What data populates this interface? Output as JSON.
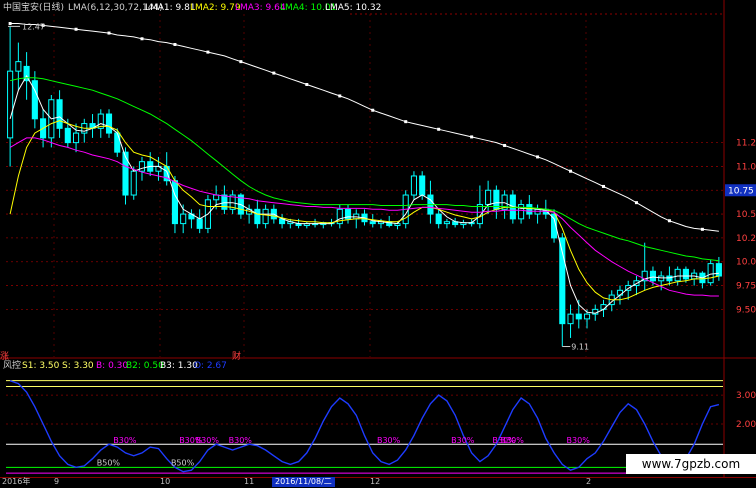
{
  "header": {
    "stock_name": "中国宝安(日线)",
    "indicator": "LMA(6,12,30,72,144)",
    "lma1": "LMA1: 9.81",
    "lma2": "LMA2: 9.79",
    "lma3": "LMA3: 9.64",
    "lma4": "LMA4: 10.01",
    "lma5": "LMA5: 10.32"
  },
  "lower_header": {
    "name": "风控",
    "s1": "S1: 3.50",
    "s": "S: 3.30",
    "b": "B: 0.30",
    "b2": "B2: 0.50",
    "b3": "B3: 1.30",
    "o": "O: 2.67"
  },
  "colors": {
    "up": "#00ffff",
    "down": "#00ffff",
    "lma1": "#ffffff",
    "lma2": "#ffff00",
    "lma3": "#ff00ff",
    "lma4": "#00ff00",
    "lma5": "#ffffff",
    "grid": "#8b0000",
    "axis_text": "#ff4040",
    "osc": "#1e3cff",
    "level_yellow": "#ffff66"
  },
  "price_labels": {
    "high": "12.47",
    "low": "9.11",
    "current": "10.75"
  },
  "tags": {
    "left": "涨",
    "mid": "财"
  },
  "watermark": "www.7gpzb.com",
  "dates": {
    "left_start": "2016年",
    "t1": "9",
    "t2": "10",
    "t3": "11",
    "t4": "12",
    "t5": "2",
    "selected": "2016/11/08/二"
  },
  "chart_data": {
    "type": "candlestick",
    "price_axis": {
      "ticks": [
        "11.25",
        "11.00",
        "10.75",
        "10.50",
        "10.25",
        "10.00",
        "9.75",
        "9.50"
      ],
      "ylim": [
        9.0,
        12.6
      ]
    },
    "candles": [
      {
        "o": 11.3,
        "h": 12.47,
        "l": 11.0,
        "c": 12.0
      },
      {
        "o": 12.0,
        "h": 12.3,
        "l": 11.8,
        "c": 12.1
      },
      {
        "o": 12.05,
        "h": 12.2,
        "l": 11.7,
        "c": 11.9
      },
      {
        "o": 11.9,
        "h": 12.0,
        "l": 11.4,
        "c": 11.5
      },
      {
        "o": 11.5,
        "h": 11.6,
        "l": 11.2,
        "c": 11.3
      },
      {
        "o": 11.3,
        "h": 11.75,
        "l": 11.2,
        "c": 11.7
      },
      {
        "o": 11.7,
        "h": 11.8,
        "l": 11.3,
        "c": 11.4
      },
      {
        "o": 11.4,
        "h": 11.5,
        "l": 11.2,
        "c": 11.25
      },
      {
        "o": 11.25,
        "h": 11.45,
        "l": 11.15,
        "c": 11.35
      },
      {
        "o": 11.35,
        "h": 11.5,
        "l": 11.25,
        "c": 11.45
      },
      {
        "o": 11.45,
        "h": 11.55,
        "l": 11.3,
        "c": 11.4
      },
      {
        "o": 11.4,
        "h": 11.6,
        "l": 11.3,
        "c": 11.55
      },
      {
        "o": 11.55,
        "h": 11.6,
        "l": 11.3,
        "c": 11.35
      },
      {
        "o": 11.35,
        "h": 11.4,
        "l": 11.1,
        "c": 11.15
      },
      {
        "o": 11.15,
        "h": 11.2,
        "l": 10.6,
        "c": 10.7
      },
      {
        "o": 10.7,
        "h": 11.0,
        "l": 10.65,
        "c": 10.95
      },
      {
        "o": 10.95,
        "h": 11.1,
        "l": 10.85,
        "c": 11.05
      },
      {
        "o": 11.05,
        "h": 11.15,
        "l": 10.9,
        "c": 10.95
      },
      {
        "o": 10.95,
        "h": 11.1,
        "l": 10.85,
        "c": 11.0
      },
      {
        "o": 11.0,
        "h": 11.15,
        "l": 10.8,
        "c": 10.85
      },
      {
        "o": 10.85,
        "h": 10.9,
        "l": 10.3,
        "c": 10.4
      },
      {
        "o": 10.4,
        "h": 10.6,
        "l": 10.3,
        "c": 10.5
      },
      {
        "o": 10.5,
        "h": 10.55,
        "l": 10.35,
        "c": 10.45
      },
      {
        "o": 10.45,
        "h": 10.55,
        "l": 10.3,
        "c": 10.35
      },
      {
        "o": 10.35,
        "h": 10.7,
        "l": 10.3,
        "c": 10.65
      },
      {
        "o": 10.65,
        "h": 10.8,
        "l": 10.55,
        "c": 10.7
      },
      {
        "o": 10.7,
        "h": 10.8,
        "l": 10.5,
        "c": 10.55
      },
      {
        "o": 10.55,
        "h": 10.75,
        "l": 10.5,
        "c": 10.7
      },
      {
        "o": 10.7,
        "h": 10.72,
        "l": 10.45,
        "c": 10.5
      },
      {
        "o": 10.5,
        "h": 10.6,
        "l": 10.4,
        "c": 10.55
      },
      {
        "o": 10.55,
        "h": 10.65,
        "l": 10.35,
        "c": 10.4
      },
      {
        "o": 10.4,
        "h": 10.6,
        "l": 10.35,
        "c": 10.55
      },
      {
        "o": 10.55,
        "h": 10.6,
        "l": 10.4,
        "c": 10.45
      },
      {
        "o": 10.45,
        "h": 10.5,
        "l": 10.35,
        "c": 10.4
      },
      {
        "o": 10.4,
        "h": 10.45,
        "l": 10.35,
        "c": 10.42
      },
      {
        "o": 10.4,
        "h": 10.45,
        "l": 10.35,
        "c": 10.38
      },
      {
        "o": 10.38,
        "h": 10.42,
        "l": 10.35,
        "c": 10.4
      },
      {
        "o": 10.4,
        "h": 10.45,
        "l": 10.36,
        "c": 10.39
      },
      {
        "o": 10.39,
        "h": 10.42,
        "l": 10.35,
        "c": 10.41
      },
      {
        "o": 10.41,
        "h": 10.45,
        "l": 10.37,
        "c": 10.4
      },
      {
        "o": 10.4,
        "h": 10.6,
        "l": 10.35,
        "c": 10.55
      },
      {
        "o": 10.55,
        "h": 10.6,
        "l": 10.4,
        "c": 10.45
      },
      {
        "o": 10.45,
        "h": 10.55,
        "l": 10.35,
        "c": 10.5
      },
      {
        "o": 10.5,
        "h": 10.55,
        "l": 10.38,
        "c": 10.42
      },
      {
        "o": 10.42,
        "h": 10.5,
        "l": 10.36,
        "c": 10.4
      },
      {
        "o": 10.4,
        "h": 10.45,
        "l": 10.35,
        "c": 10.42
      },
      {
        "o": 10.42,
        "h": 10.48,
        "l": 10.36,
        "c": 10.38
      },
      {
        "o": 10.38,
        "h": 10.42,
        "l": 10.34,
        "c": 10.4
      },
      {
        "o": 10.4,
        "h": 10.75,
        "l": 10.35,
        "c": 10.7
      },
      {
        "o": 10.7,
        "h": 10.95,
        "l": 10.65,
        "c": 10.9
      },
      {
        "o": 10.9,
        "h": 10.95,
        "l": 10.65,
        "c": 10.7
      },
      {
        "o": 10.7,
        "h": 10.85,
        "l": 10.4,
        "c": 10.5
      },
      {
        "o": 10.5,
        "h": 10.55,
        "l": 10.35,
        "c": 10.4
      },
      {
        "o": 10.4,
        "h": 10.45,
        "l": 10.35,
        "c": 10.42
      },
      {
        "o": 10.42,
        "h": 10.46,
        "l": 10.36,
        "c": 10.39
      },
      {
        "o": 10.39,
        "h": 10.44,
        "l": 10.35,
        "c": 10.41
      },
      {
        "o": 10.41,
        "h": 10.45,
        "l": 10.37,
        "c": 10.4
      },
      {
        "o": 10.4,
        "h": 10.8,
        "l": 10.35,
        "c": 10.6
      },
      {
        "o": 10.6,
        "h": 10.85,
        "l": 10.5,
        "c": 10.75
      },
      {
        "o": 10.75,
        "h": 10.8,
        "l": 10.45,
        "c": 10.55
      },
      {
        "o": 10.55,
        "h": 10.75,
        "l": 10.45,
        "c": 10.7
      },
      {
        "o": 10.7,
        "h": 10.75,
        "l": 10.4,
        "c": 10.45
      },
      {
        "o": 10.45,
        "h": 10.65,
        "l": 10.4,
        "c": 10.6
      },
      {
        "o": 10.6,
        "h": 10.7,
        "l": 10.45,
        "c": 10.5
      },
      {
        "o": 10.5,
        "h": 10.6,
        "l": 10.4,
        "c": 10.55
      },
      {
        "o": 10.55,
        "h": 10.65,
        "l": 10.45,
        "c": 10.5
      },
      {
        "o": 10.5,
        "h": 10.55,
        "l": 10.2,
        "c": 10.25
      },
      {
        "o": 10.25,
        "h": 10.3,
        "l": 9.11,
        "c": 9.35
      },
      {
        "o": 9.35,
        "h": 9.55,
        "l": 9.2,
        "c": 9.45
      },
      {
        "o": 9.45,
        "h": 9.6,
        "l": 9.3,
        "c": 9.4
      },
      {
        "o": 9.4,
        "h": 9.5,
        "l": 9.3,
        "c": 9.45
      },
      {
        "o": 9.45,
        "h": 9.55,
        "l": 9.38,
        "c": 9.5
      },
      {
        "o": 9.5,
        "h": 9.6,
        "l": 9.42,
        "c": 9.55
      },
      {
        "o": 9.55,
        "h": 9.7,
        "l": 9.48,
        "c": 9.65
      },
      {
        "o": 9.65,
        "h": 9.75,
        "l": 9.55,
        "c": 9.7
      },
      {
        "o": 9.7,
        "h": 9.8,
        "l": 9.6,
        "c": 9.75
      },
      {
        "o": 9.75,
        "h": 9.85,
        "l": 9.65,
        "c": 9.8
      },
      {
        "o": 9.8,
        "h": 10.2,
        "l": 9.7,
        "c": 9.9
      },
      {
        "o": 9.9,
        "h": 9.95,
        "l": 9.75,
        "c": 9.8
      },
      {
        "o": 9.8,
        "h": 9.9,
        "l": 9.7,
        "c": 9.85
      },
      {
        "o": 9.85,
        "h": 9.95,
        "l": 9.75,
        "c": 9.8
      },
      {
        "o": 9.8,
        "h": 9.95,
        "l": 9.75,
        "c": 9.92
      },
      {
        "o": 9.92,
        "h": 9.95,
        "l": 9.78,
        "c": 9.82
      },
      {
        "o": 9.82,
        "h": 9.92,
        "l": 9.75,
        "c": 9.88
      },
      {
        "o": 9.88,
        "h": 9.9,
        "l": 9.72,
        "c": 9.78
      },
      {
        "o": 9.78,
        "h": 10.02,
        "l": 9.75,
        "c": 9.98
      },
      {
        "o": 9.98,
        "h": 10.05,
        "l": 9.8,
        "c": 9.85
      }
    ],
    "lma_lines": [
      {
        "name": "LMA1",
        "values": [
          11.5,
          11.8,
          11.95,
          11.8,
          11.6,
          11.5,
          11.52,
          11.45,
          11.38,
          11.37,
          11.4,
          11.45,
          11.42,
          11.35,
          11.1,
          10.95,
          10.98,
          11.0,
          11.0,
          10.95,
          10.7,
          10.55,
          10.5,
          10.45,
          10.5,
          10.6,
          10.62,
          10.62,
          10.6,
          10.55,
          10.5,
          10.5,
          10.5,
          10.45,
          10.42,
          10.4,
          10.4,
          10.4,
          10.4,
          10.4,
          10.45,
          10.47,
          10.47,
          10.46,
          10.43,
          10.42,
          10.41,
          10.4,
          10.5,
          10.65,
          10.7,
          10.65,
          10.55,
          10.47,
          10.42,
          10.41,
          10.41,
          10.48,
          10.6,
          10.62,
          10.62,
          10.58,
          10.56,
          10.56,
          10.55,
          10.54,
          10.45,
          10.1,
          9.75,
          9.55,
          9.47,
          9.46,
          9.5,
          9.58,
          9.65,
          9.72,
          9.77,
          9.82,
          9.84,
          9.83,
          9.83,
          9.85,
          9.85,
          9.85,
          9.83,
          9.87,
          9.88
        ]
      },
      {
        "name": "LMA2",
        "values": [
          10.5,
          10.9,
          11.2,
          11.35,
          11.4,
          11.45,
          11.48,
          11.45,
          11.42,
          11.4,
          11.4,
          11.42,
          11.42,
          11.38,
          11.25,
          11.15,
          11.12,
          11.1,
          11.05,
          11.0,
          10.85,
          10.75,
          10.68,
          10.6,
          10.58,
          10.58,
          10.58,
          10.57,
          10.55,
          10.53,
          10.5,
          10.49,
          10.48,
          10.46,
          10.44,
          10.43,
          10.42,
          10.42,
          10.41,
          10.41,
          10.43,
          10.44,
          10.45,
          10.45,
          10.44,
          10.43,
          10.42,
          10.42,
          10.46,
          10.52,
          10.57,
          10.57,
          10.55,
          10.52,
          10.49,
          10.47,
          10.45,
          10.47,
          10.52,
          10.55,
          10.57,
          10.57,
          10.57,
          10.56,
          10.56,
          10.55,
          10.52,
          10.35,
          10.12,
          9.92,
          9.78,
          9.68,
          9.62,
          9.6,
          9.6,
          9.62,
          9.66,
          9.7,
          9.73,
          9.75,
          9.77,
          9.79,
          9.8,
          9.82,
          9.82,
          9.83,
          9.85
        ]
      },
      {
        "name": "LMA3",
        "values": [
          11.2,
          11.25,
          11.3,
          11.3,
          11.28,
          11.25,
          11.22,
          11.2,
          11.17,
          11.15,
          11.12,
          11.1,
          11.08,
          11.05,
          11.0,
          10.97,
          10.94,
          10.92,
          10.9,
          10.88,
          10.84,
          10.8,
          10.77,
          10.74,
          10.72,
          10.7,
          10.69,
          10.68,
          10.67,
          10.66,
          10.64,
          10.63,
          10.62,
          10.61,
          10.6,
          10.59,
          10.58,
          10.58,
          10.57,
          10.57,
          10.56,
          10.56,
          10.56,
          10.56,
          10.55,
          10.55,
          10.54,
          10.54,
          10.55,
          10.56,
          10.57,
          10.57,
          10.56,
          10.55,
          10.54,
          10.53,
          10.52,
          10.52,
          10.53,
          10.53,
          10.54,
          10.54,
          10.54,
          10.53,
          10.53,
          10.53,
          10.52,
          10.45,
          10.36,
          10.28,
          10.2,
          10.12,
          10.06,
          10.0,
          9.95,
          9.9,
          9.86,
          9.82,
          9.78,
          9.74,
          9.7,
          9.68,
          9.66,
          9.65,
          9.65,
          9.64,
          9.64
        ]
      },
      {
        "name": "LMA4",
        "values": [
          11.9,
          11.92,
          11.93,
          11.93,
          11.92,
          11.9,
          11.88,
          11.86,
          11.84,
          11.82,
          11.8,
          11.77,
          11.74,
          11.71,
          11.67,
          11.63,
          11.59,
          11.55,
          11.5,
          11.45,
          11.39,
          11.33,
          11.27,
          11.2,
          11.13,
          11.06,
          10.99,
          10.92,
          10.85,
          10.79,
          10.74,
          10.7,
          10.67,
          10.65,
          10.63,
          10.62,
          10.61,
          10.6,
          10.6,
          10.6,
          10.6,
          10.6,
          10.6,
          10.6,
          10.6,
          10.59,
          10.59,
          10.59,
          10.59,
          10.6,
          10.6,
          10.6,
          10.6,
          10.6,
          10.59,
          10.59,
          10.58,
          10.58,
          10.58,
          10.58,
          10.58,
          10.57,
          10.57,
          10.57,
          10.56,
          10.55,
          10.54,
          10.5,
          10.45,
          10.4,
          10.36,
          10.33,
          10.3,
          10.27,
          10.24,
          10.22,
          10.19,
          10.16,
          10.14,
          10.12,
          10.1,
          10.08,
          10.06,
          10.05,
          10.03,
          10.02,
          10.01
        ]
      },
      {
        "name": "LMA5",
        "values": [
          12.5,
          12.5,
          12.49,
          12.49,
          12.48,
          12.47,
          12.46,
          12.45,
          12.44,
          12.43,
          12.42,
          12.41,
          12.4,
          12.38,
          12.37,
          12.36,
          12.34,
          12.33,
          12.31,
          12.3,
          12.28,
          12.26,
          12.24,
          12.22,
          12.2,
          12.18,
          12.16,
          12.13,
          12.1,
          12.07,
          12.04,
          12.01,
          11.98,
          11.95,
          11.92,
          11.89,
          11.86,
          11.83,
          11.8,
          11.77,
          11.74,
          11.71,
          11.67,
          11.63,
          11.59,
          11.56,
          11.53,
          11.5,
          11.47,
          11.45,
          11.43,
          11.41,
          11.39,
          11.37,
          11.35,
          11.33,
          11.31,
          11.29,
          11.27,
          11.25,
          11.22,
          11.19,
          11.16,
          11.13,
          11.1,
          11.07,
          11.03,
          10.99,
          10.95,
          10.91,
          10.87,
          10.83,
          10.79,
          10.75,
          10.71,
          10.67,
          10.62,
          10.57,
          10.52,
          10.47,
          10.43,
          10.4,
          10.37,
          10.35,
          10.34,
          10.33,
          10.32
        ]
      }
    ],
    "oscillator": {
      "axis_ticks": [
        "3.00",
        "2.00"
      ],
      "ylim": [
        0.2,
        3.8
      ],
      "levels": [
        {
          "name": "S1",
          "value": 3.5,
          "color": "#ffff66"
        },
        {
          "name": "S",
          "value": 3.3,
          "color": "#ffff66"
        },
        {
          "name": "B3",
          "value": 1.3,
          "color": "#ffffff"
        },
        {
          "name": "B2",
          "value": 0.5,
          "color": "#00ff00"
        },
        {
          "name": "B",
          "value": 0.3,
          "color": "#ff00ff"
        }
      ],
      "values": [
        3.5,
        3.4,
        3.1,
        2.6,
        2.0,
        1.4,
        0.9,
        0.6,
        0.5,
        0.55,
        0.8,
        1.1,
        1.3,
        1.2,
        1.0,
        0.9,
        1.0,
        1.2,
        1.15,
        0.8,
        0.5,
        0.35,
        0.4,
        0.7,
        1.1,
        1.3,
        1.2,
        1.1,
        1.2,
        1.3,
        1.25,
        1.1,
        0.9,
        0.7,
        0.6,
        0.7,
        1.0,
        1.5,
        2.1,
        2.6,
        2.9,
        2.7,
        2.3,
        1.6,
        1.0,
        0.7,
        0.6,
        0.75,
        1.1,
        1.6,
        2.2,
        2.7,
        3.0,
        2.8,
        2.3,
        1.6,
        1.0,
        0.7,
        0.9,
        1.3,
        1.9,
        2.5,
        2.9,
        2.7,
        2.2,
        1.5,
        1.0,
        0.6,
        0.4,
        0.5,
        0.8,
        1.0,
        1.4,
        1.9,
        2.4,
        2.7,
        2.5,
        2.0,
        1.4,
        0.9,
        0.6,
        0.5,
        0.8,
        1.3,
        2.0,
        2.6,
        2.67
      ],
      "markers": [
        {
          "label": "B30%",
          "index": 13
        },
        {
          "label": "B30%",
          "index": 21
        },
        {
          "label": "B30%",
          "index": 23
        },
        {
          "label": "B30%",
          "index": 27
        },
        {
          "label": "B30%",
          "index": 45
        },
        {
          "label": "B30%",
          "index": 54
        },
        {
          "label": "B30%",
          "index": 59
        },
        {
          "label": "B30%",
          "index": 60
        },
        {
          "label": "B30%",
          "index": 68
        },
        {
          "label": "B50%",
          "index": 11
        },
        {
          "label": "B50%",
          "index": 20
        }
      ]
    }
  }
}
